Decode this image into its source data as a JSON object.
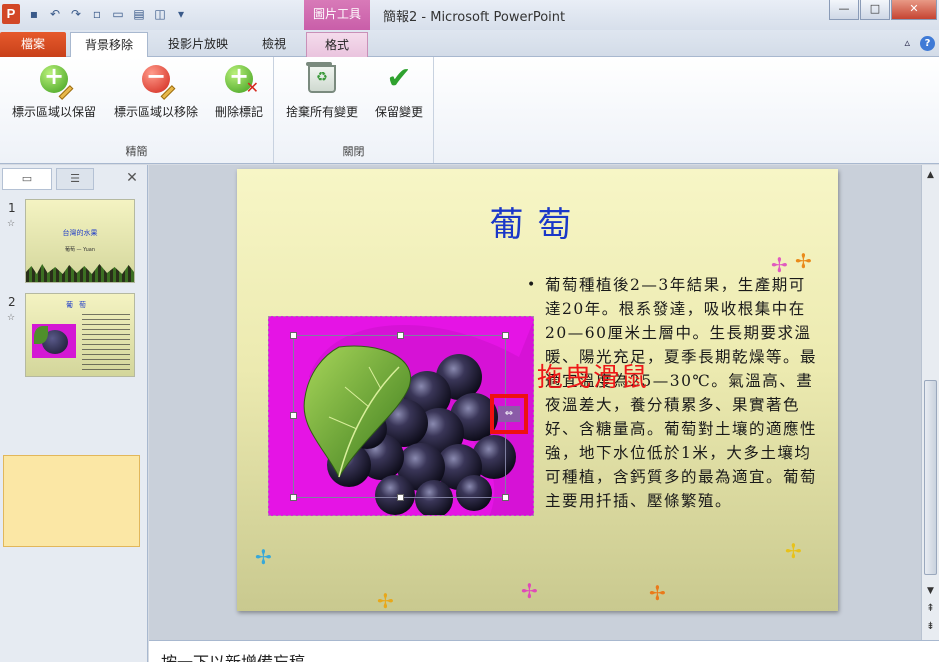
{
  "window": {
    "app_icon_letter": "P",
    "title": "簡報2 - Microsoft PowerPoint",
    "context_tool_title": "圖片工具",
    "minimize": "—",
    "maximize": "□",
    "close": "✕"
  },
  "tabs": [
    {
      "label": "檔案"
    },
    {
      "label": "背景移除"
    },
    {
      "label": "投影片放映"
    },
    {
      "label": "檢視"
    },
    {
      "label": "格式"
    }
  ],
  "ribbon": {
    "groups": [
      {
        "label": "精簡",
        "buttons": [
          {
            "label": "標示區域以保留",
            "icon": "add-mark-icon"
          },
          {
            "label": "標示區域以移除",
            "icon": "remove-mark-icon"
          },
          {
            "label": "刪除標記",
            "icon": "delete-mark-icon"
          }
        ]
      },
      {
        "label": "關閉",
        "buttons": [
          {
            "label": "捨棄所有變更",
            "icon": "discard-icon"
          },
          {
            "label": "保留變更",
            "icon": "keep-changes-icon"
          }
        ]
      }
    ]
  },
  "slide_pane": {
    "thumbnails": [
      {
        "number": "1",
        "star": "☆",
        "title": "台灣的水果",
        "subtitle": "葡萄 — Yuan"
      },
      {
        "number": "2",
        "star": "☆",
        "title": "葡萄"
      }
    ],
    "close": "✕"
  },
  "slide": {
    "title": "葡萄",
    "bullet": "•",
    "body": "葡萄種植後2—3年結果，生產期可達20年。根系發達，吸收根集中在20—60厘米土層中。生長期要求溫暖、陽光充足，夏季長期乾燥等。最適宜溫度為25—30℃。氣溫高、晝夜溫差大，養分積累多、果實著色好、含糖量高。葡萄對土壤的適應性強，地下水位低於1米，大多土壤均可種植，含鈣質多的最為適宜。葡萄主要用扦插、壓條繁殖。",
    "annotation": "拖曳滑鼠",
    "drag_handle_glyph": "⇔"
  },
  "notes": {
    "text": "按一下以新增備忘稿"
  },
  "colors": {
    "file_tab": "#d24726",
    "title_text": "#1a37c8",
    "picture_bg": "#e514e5",
    "annotation": "#ee1818"
  }
}
